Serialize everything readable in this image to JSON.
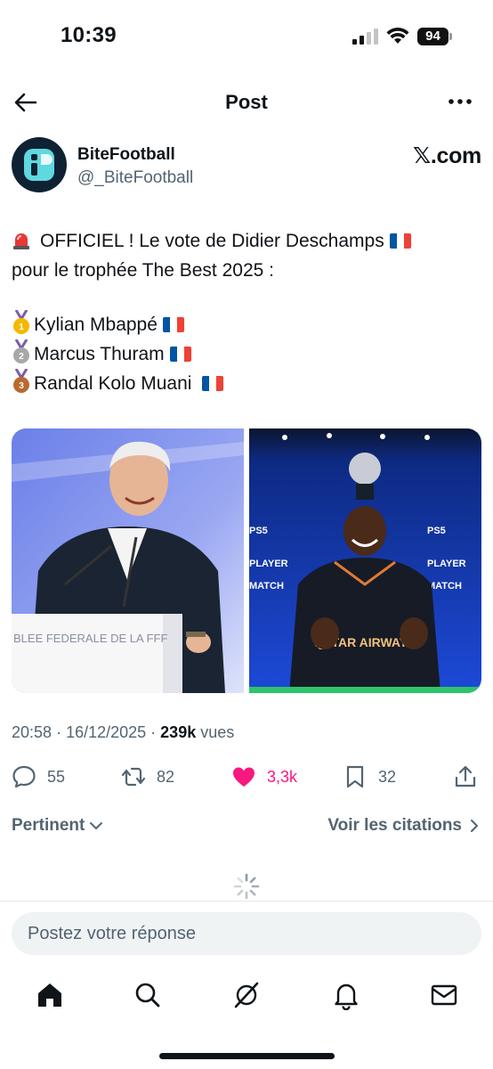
{
  "status_bar": {
    "time": "10:39",
    "battery": "94"
  },
  "header": {
    "title": "Post"
  },
  "author": {
    "name": "BiteFootball",
    "handle": "@_BiteFootball",
    "source": "𝕏.com"
  },
  "tweet": {
    "line1": "OFFICIEL ! Le vote de Didier Deschamps",
    "line2": "pour le trophée The Best 2025 :",
    "ranking": [
      "Kylian Mbappé",
      "Marcus Thuram",
      "Randal Kolo Muani"
    ]
  },
  "media": {
    "left_banner": "BLEE FEDERALE DE LA FFF",
    "right_badges": [
      "PLAYER OF THE MATCH",
      "QATAR AIRWAYS",
      "PS5"
    ]
  },
  "meta": {
    "time": "20:58",
    "date": "16/12/2025",
    "views": "239k",
    "views_label": "vues"
  },
  "actions": {
    "replies": "55",
    "reposts": "82",
    "likes": "3,3k",
    "bookmarks": "32"
  },
  "sort": {
    "left": "Pertinent",
    "right": "Voir les citations"
  },
  "reply": {
    "placeholder": "Postez votre réponse"
  },
  "colors": {
    "accent_like": "#f91880",
    "muted": "#536471",
    "text": "#0f1419"
  }
}
